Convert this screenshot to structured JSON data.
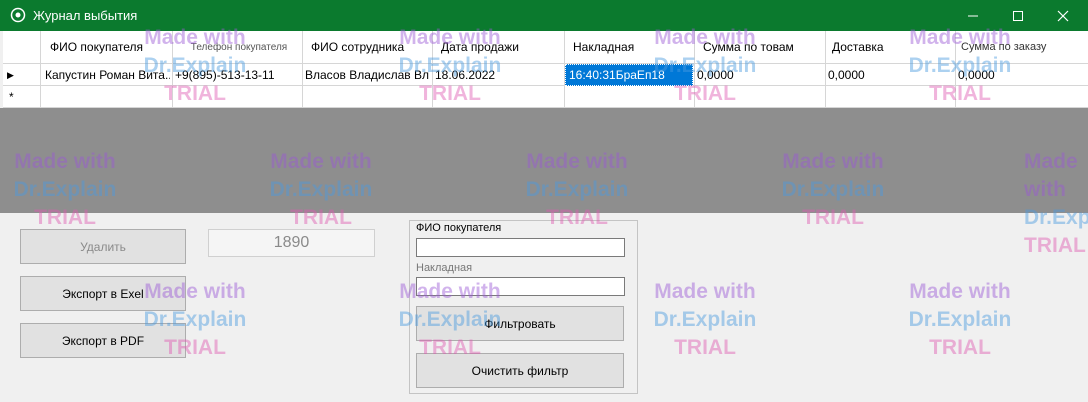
{
  "window": {
    "title": "Журнал выбытия",
    "controls": [
      "minimize",
      "maximize",
      "close"
    ]
  },
  "grid": {
    "columns": [
      {
        "label": "ФИО покупателя"
      },
      {
        "label": "Телефон покупателя"
      },
      {
        "label": "ФИО сотрудника"
      },
      {
        "label": "Дата продажи"
      },
      {
        "label": "Накладная"
      },
      {
        "label": "Сумма по товам"
      },
      {
        "label": "Доставка"
      },
      {
        "label": "Сумма по заказу"
      }
    ],
    "rows": [
      {
        "indicator": "▶",
        "cells": [
          "Капустин Роман Вита...",
          "+9(895)-513-13-11",
          "Власов Владислав Вл...",
          "18.06.2022",
          "16:40:31БраЕп18",
          "0,0000",
          "0,0000",
          "0,0000"
        ]
      }
    ],
    "new_row_indicator": "*",
    "selected_cell": "16:40:31БраЕп18"
  },
  "actions": {
    "delete_label": "Удалить",
    "export_excel_label": "Экспорт в Exel",
    "export_pdf_label": "Экспорт в PDF",
    "counter_value": "1890"
  },
  "filter": {
    "buyer_label": "ФИО покупателя",
    "buyer_value": "",
    "invoice_label": "Накладная",
    "invoice_value": "",
    "apply_label": "Фильтровать",
    "clear_label": "Очистить фильтр"
  },
  "watermark": {
    "line1": "Made with",
    "line2": "Dr.Explain",
    "line3": "TRIAL"
  },
  "colors": {
    "titlebar": "#0b7a2e",
    "selection": "#0078d7",
    "dim_overlay": "#8e8e8e"
  }
}
